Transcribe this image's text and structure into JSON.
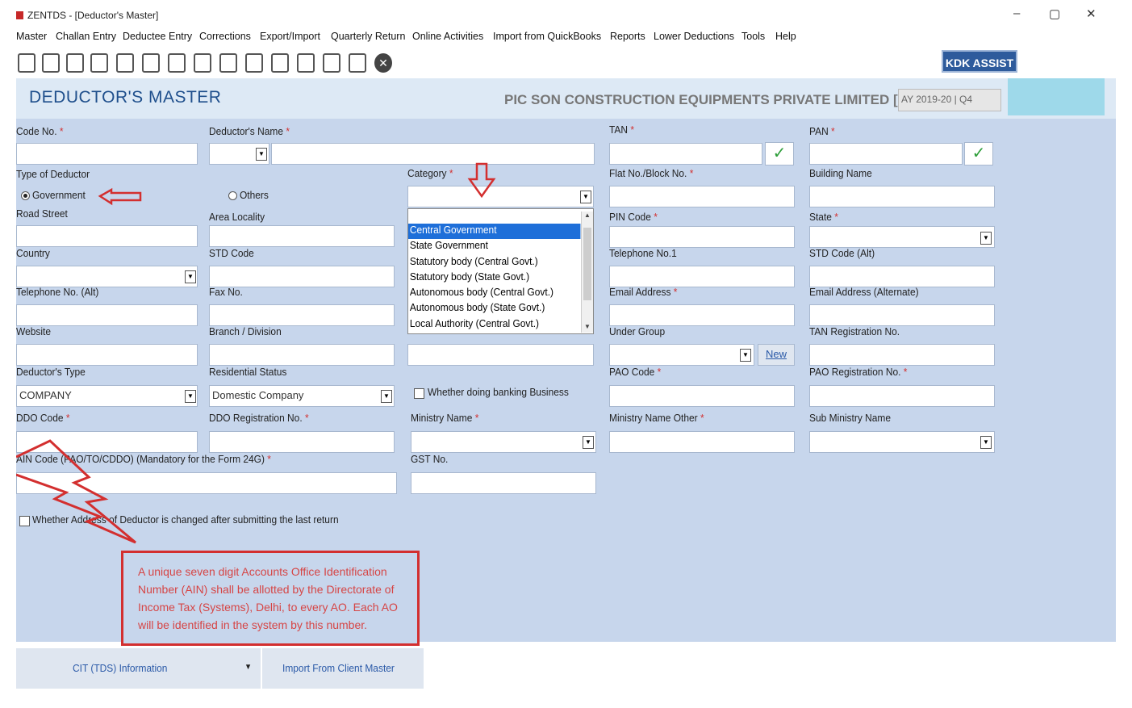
{
  "window": {
    "title": "ZENTDS - [Deductor's Master]",
    "minimize": "–",
    "restore": "▢",
    "close": "✕"
  },
  "menu": [
    "Master",
    "Challan Entry",
    "Deductee Entry",
    "Corrections",
    "Export/Import",
    "Quarterly Return",
    "Online Activities",
    "Import from QuickBooks",
    "Reports",
    "Lower Deductions",
    "Tools",
    "Help"
  ],
  "toolbar": {
    "assist_label": "KDK ASSIST"
  },
  "header": {
    "title": "DEDUCTOR'S MASTER",
    "company": "PIC SON CONSTRUCTION EQUIPMENTS PRIVATE LIMITED [01]",
    "ay": "AY 2019-20 | Q4"
  },
  "labels": {
    "code_no": "Code No.",
    "deductor_name": "Deductor's Name",
    "tan": "TAN",
    "pan": "PAN",
    "type_of_deductor": "Type of Deductor",
    "government": "Government",
    "others": "Others",
    "category": "Category",
    "flat_no": "Flat No./Block No.",
    "building": "Building Name",
    "road": "Road Street",
    "area": "Area Locality",
    "pin": "PIN Code",
    "state": "State",
    "country": "Country",
    "std": "STD Code",
    "tel1": "Telephone No.1",
    "std_alt": "STD Code (Alt)",
    "tel_alt": "Telephone No. (Alt)",
    "fax": "Fax No.",
    "email": "Email Address",
    "email_alt": "Email Address (Alternate)",
    "website": "Website",
    "branch": "Branch / Division",
    "under_group": "Under Group",
    "new_link": "New",
    "tan_reg": "TAN Registration No.",
    "deductor_type": "Deductor's Type",
    "residential": "Residential Status",
    "banking": "Whether doing banking Business",
    "pao_code": "PAO Code",
    "pao_reg": "PAO Registration No.",
    "ddo_code": "DDO Code",
    "ddo_reg": "DDO Registration No.",
    "ministry": "Ministry Name",
    "ministry_other": "Ministry Name Other",
    "sub_ministry": "Sub Ministry Name",
    "ain_code": "AIN Code (PAO/TO/CDDO) (Mandatory for the Form 24G)",
    "gst": "GST No.",
    "address_changed": "Whether Address of Deductor is changed after submitting the last return"
  },
  "values": {
    "deductor_type": "COMPANY",
    "residential": "Domestic Company"
  },
  "category_options": [
    "Central Government",
    "State Government",
    "Statutory body (Central Govt.)",
    "Statutory body (State Govt.)",
    "Autonomous body (Central Govt.)",
    "Autonomous body (State Govt.)",
    "Local Authority (Central Govt.)"
  ],
  "note": "A unique seven digit Accounts Office Identification Number (AIN) shall be allotted by the Directorate of Income Tax (Systems), Delhi, to every AO. Each AO will be identified in the system by this number.",
  "bottom": {
    "cit_label": "CIT (TDS) Information",
    "import_label": "Import From Client Master"
  },
  "colors": {
    "form_bg": "#c7d6ec",
    "header_bg": "#dde9f5",
    "title_blue": "#1f4f8c",
    "annotation_red": "#d32f2f",
    "selection_blue": "#1e6fd9"
  }
}
